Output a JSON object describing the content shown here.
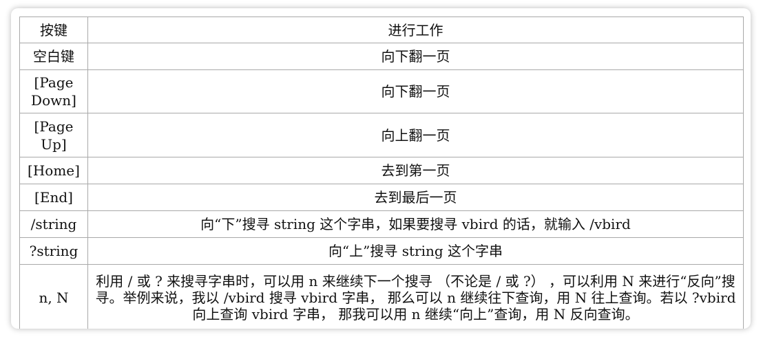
{
  "table": {
    "headers": [
      "按键",
      "进行工作"
    ],
    "rows": [
      {
        "key": "空白键",
        "action": "向下翻一页"
      },
      {
        "key": "[Page Down]",
        "action": "向下翻一页"
      },
      {
        "key": "[Page Up]",
        "action": "向上翻一页"
      },
      {
        "key": "[Home]",
        "action": "去到第一页"
      },
      {
        "key": "[End]",
        "action": "去到最后一页"
      },
      {
        "key": "/string",
        "action": "向“下”搜寻 string 这个字串，如果要搜寻 vbird 的话，就输入 /vbird"
      },
      {
        "key": "?string",
        "action": "向“上”搜寻 string 这个字串"
      },
      {
        "key": "n, N",
        "action": "利用 / 或 ? 来搜寻字串时，可以用 n 来继续下一个搜寻 （不论是 / 或 ?） ，可以利用 N 来进行“反向”搜寻。举例来说，我以 /vbird 搜寻 vbird 字串， 那么可以 n 继续往下查询，用 N 往上查询。若以 ?vbird 向上查询 vbird 字串， 那我可以用 n 继续“向上”查询，用 N 反向查询。"
      }
    ]
  }
}
